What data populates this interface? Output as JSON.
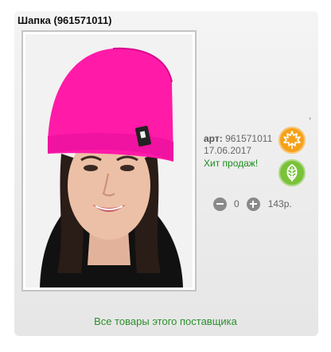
{
  "product": {
    "title": "Шапка (961571011)",
    "art_label": "арт:",
    "art_value": "961571011",
    "date": "17.06.2017",
    "hit_label": "Хит продаж!",
    "quantity": "0",
    "price": "143р.",
    "photo_description_icon": "product-photo"
  },
  "badges": [
    {
      "icon": "maple-leaf-icon",
      "color": "#f6a11a"
    },
    {
      "icon": "leaf-icon",
      "color": "#7ac23a"
    }
  ],
  "footer": {
    "supplier_link": "Все товары этого поставщика"
  },
  "colors": {
    "accent_green": "#2c8f2c",
    "hat_pink": "#ff1aa8"
  }
}
